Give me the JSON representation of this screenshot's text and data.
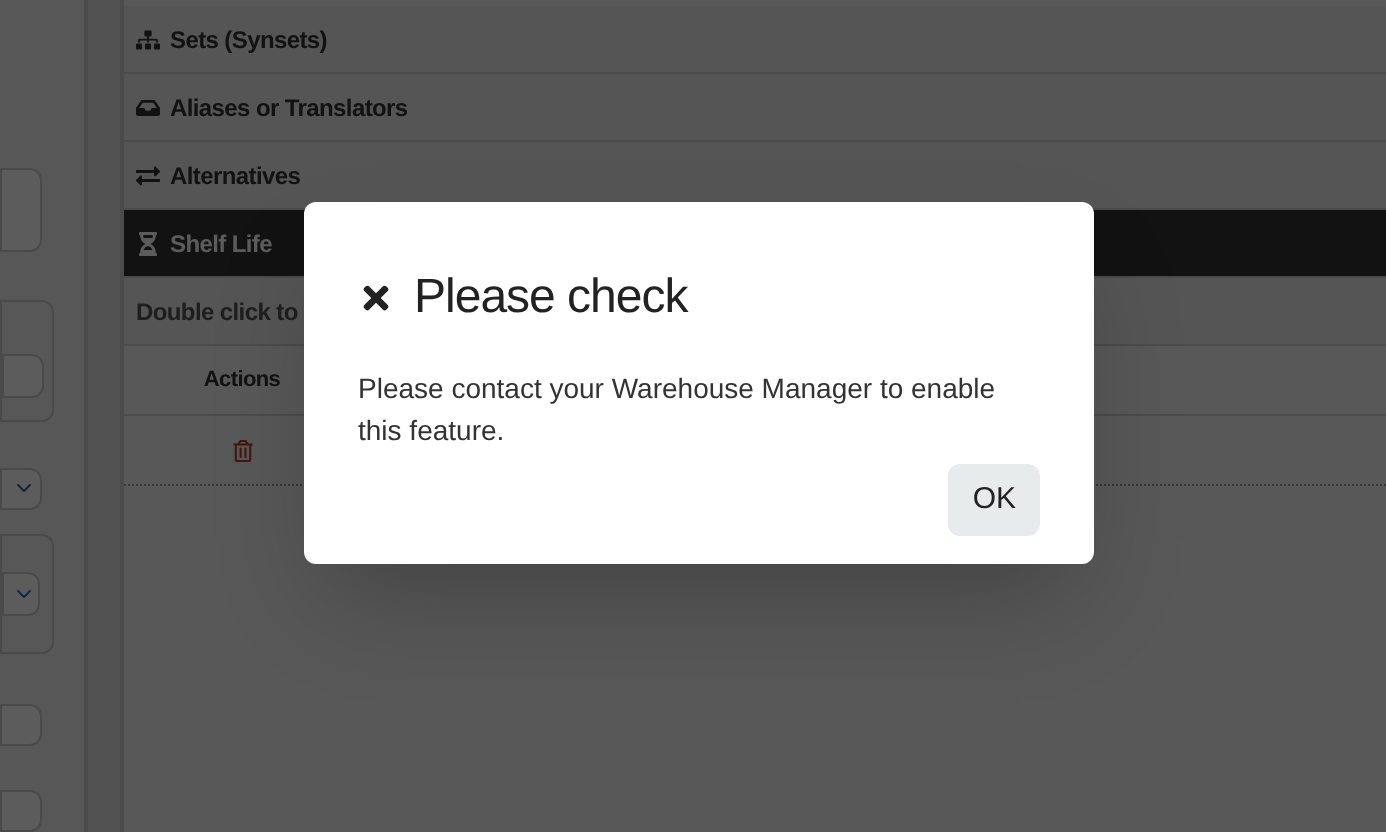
{
  "accordion": [
    {
      "label": "Sets (Synsets)",
      "selected": false
    },
    {
      "label": "Aliases or Translators",
      "selected": false
    },
    {
      "label": "Alternatives",
      "selected": false
    },
    {
      "label": "Shelf Life",
      "selected": true
    }
  ],
  "hint": "Double click to",
  "table": {
    "columns": [
      "Actions"
    ]
  },
  "dialog": {
    "title": "Please check",
    "message": "Please contact your Warehouse Manager to enable this feature.",
    "buttons": [
      "OK"
    ]
  }
}
